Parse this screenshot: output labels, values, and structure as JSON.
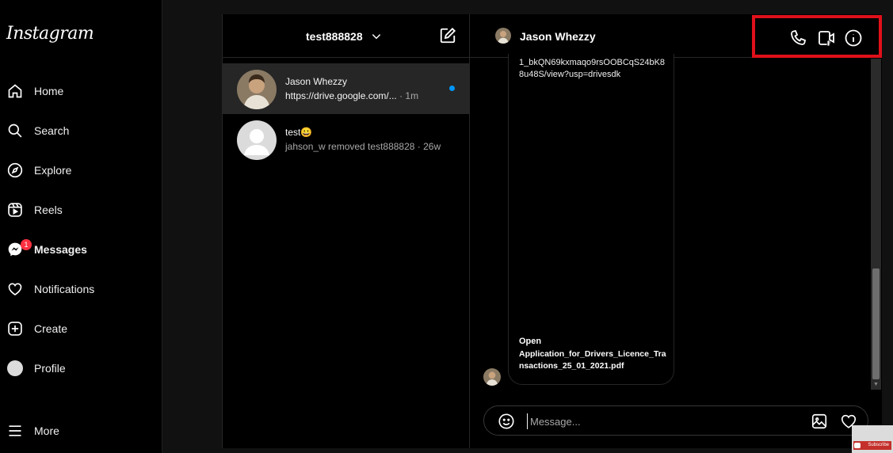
{
  "app": {
    "logo": "Instagram"
  },
  "nav": {
    "items": [
      {
        "label": "Home",
        "icon": "home-icon"
      },
      {
        "label": "Search",
        "icon": "search-icon"
      },
      {
        "label": "Explore",
        "icon": "compass-icon"
      },
      {
        "label": "Reels",
        "icon": "reels-icon"
      },
      {
        "label": "Messages",
        "icon": "messenger-icon",
        "badge": "1",
        "active": true
      },
      {
        "label": "Notifications",
        "icon": "heart-icon"
      },
      {
        "label": "Create",
        "icon": "plus-square-icon"
      },
      {
        "label": "Profile",
        "icon": "avatar-icon"
      },
      {
        "label": "More",
        "icon": "menu-icon"
      }
    ]
  },
  "inbox": {
    "account": "test888828",
    "conversations": [
      {
        "name": "Jason Whezzy",
        "preview": "https://drive.google.com/...",
        "time": "· 1m",
        "unread": true,
        "selected": true
      },
      {
        "name": "test😀",
        "preview": "jahson_w removed test888828",
        "time": "· 26w",
        "unread": false,
        "selected": false
      }
    ]
  },
  "chat": {
    "name": "Jason Whezzy",
    "link_text": "1_bkQN69kxmaqo9rsOOBCqS24bK88u48S/view?usp=drivesdk",
    "open_label": "Open",
    "file_name": "Application_for_Drivers_Licence_Transactions_25_01_2021.pdf",
    "composer_placeholder": "Message...",
    "header_icons": [
      "phone-icon",
      "video-call-icon",
      "info-icon"
    ]
  },
  "overlay": {
    "subscribe": "Subscribe"
  },
  "colors": {
    "accent": "#0095f6",
    "highlight": "#e0101a",
    "badge": "#ff3040"
  }
}
